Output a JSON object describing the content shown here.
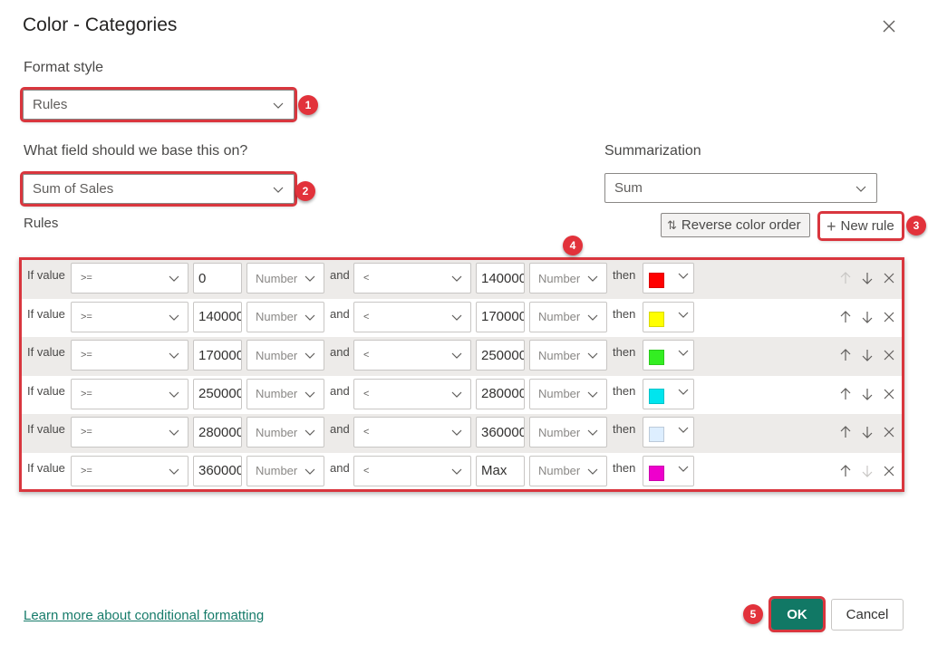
{
  "dialog": {
    "title": "Color - Categories",
    "close_icon": "close-icon"
  },
  "format_style": {
    "label": "Format style",
    "value": "Rules"
  },
  "base_field": {
    "label": "What field should we base this on?",
    "value": "Sum of Sales"
  },
  "summarization": {
    "label": "Summarization",
    "value": "Sum"
  },
  "rules_section": {
    "label": "Rules",
    "reverse_button": "Reverse color order",
    "reverse_icon": "sort-arrows-icon",
    "new_rule_button": "New rule",
    "new_rule_icon": "plus-icon"
  },
  "rules": [
    {
      "if_label": "If value",
      "op1": ">=",
      "val1": "0",
      "type1": "Number",
      "and_label": "and",
      "op2": "<",
      "val2": "140000",
      "type2": "Number",
      "then_label": "then",
      "color": "#ff0000",
      "up_enabled": false,
      "down_enabled": true
    },
    {
      "if_label": "If value",
      "op1": ">=",
      "val1": "140000",
      "type1": "Number",
      "and_label": "and",
      "op2": "<",
      "val2": "170000",
      "type2": "Number",
      "then_label": "then",
      "color": "#ffff00",
      "up_enabled": true,
      "down_enabled": true
    },
    {
      "if_label": "If value",
      "op1": ">=",
      "val1": "170000",
      "type1": "Number",
      "and_label": "and",
      "op2": "<",
      "val2": "250000",
      "type2": "Number",
      "then_label": "then",
      "color": "#33ee22",
      "up_enabled": true,
      "down_enabled": true
    },
    {
      "if_label": "If value",
      "op1": ">=",
      "val1": "250000",
      "type1": "Number",
      "and_label": "and",
      "op2": "<",
      "val2": "280000",
      "type2": "Number",
      "then_label": "then",
      "color": "#00e5ee",
      "up_enabled": true,
      "down_enabled": true
    },
    {
      "if_label": "If value",
      "op1": ">=",
      "val1": "280000",
      "type1": "Number",
      "and_label": "and",
      "op2": "<",
      "val2": "360000",
      "type2": "Number",
      "then_label": "then",
      "color": "#ddeeff",
      "up_enabled": true,
      "down_enabled": true
    },
    {
      "if_label": "If value",
      "op1": ">=",
      "val1": "360000",
      "type1": "Number",
      "and_label": "and",
      "op2": "<",
      "val2": "Max",
      "type2": "Number",
      "then_label": "then",
      "color": "#ee00cc",
      "up_enabled": true,
      "down_enabled": false
    }
  ],
  "annotations": [
    "1",
    "2",
    "3",
    "4",
    "5"
  ],
  "footer": {
    "learn_more_link": "Learn more about conditional formatting",
    "ok_button": "OK",
    "cancel_button": "Cancel"
  },
  "colors": {
    "accent": "#117865",
    "link": "#167b6a",
    "highlight": "#d9363e"
  }
}
